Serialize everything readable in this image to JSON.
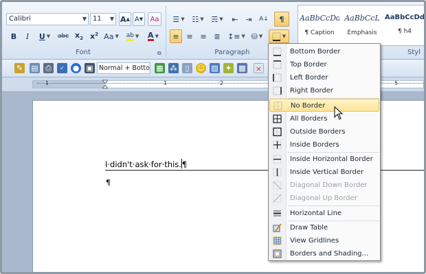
{
  "font_group": {
    "font_name": "Calibri",
    "font_size": "11",
    "label": "Font"
  },
  "paragraph_group": {
    "label": "Paragraph"
  },
  "styles_group": {
    "label": "Styl",
    "tiles": [
      {
        "sample": "AaBbCcDd",
        "name": "¶ Caption"
      },
      {
        "sample": "AaBbCcL",
        "name": "Emphasis"
      },
      {
        "sample": "AaBbCcDd",
        "name": "¶ h4"
      }
    ]
  },
  "quick_toolbar": {
    "style_box": "Normal + Botto"
  },
  "ruler": {
    "numbers": [
      "1",
      "1",
      "2",
      "5"
    ]
  },
  "document": {
    "line1": "I·didn't·ask·for·this.",
    "pilcrow": "¶",
    "para2": "¶"
  },
  "border_menu": {
    "items": [
      {
        "label": "Bottom Border",
        "icon": "bottom-border-icon",
        "enabled": true
      },
      {
        "label": "Top Border",
        "icon": "top-border-icon",
        "enabled": true
      },
      {
        "label": "Left Border",
        "icon": "left-border-icon",
        "enabled": true
      },
      {
        "label": "Right Border",
        "icon": "right-border-icon",
        "enabled": true
      },
      {
        "label": "No Border",
        "icon": "no-border-icon",
        "enabled": true,
        "highlighted": true
      },
      {
        "label": "All Borders",
        "icon": "all-borders-icon",
        "enabled": true
      },
      {
        "label": "Outside Borders",
        "icon": "outside-borders-icon",
        "enabled": true
      },
      {
        "label": "Inside Borders",
        "icon": "inside-borders-icon",
        "enabled": true
      },
      {
        "label": "Inside Horizontal Border",
        "icon": "inside-horizontal-border-icon",
        "enabled": true
      },
      {
        "label": "Inside Vertical Border",
        "icon": "inside-vertical-border-icon",
        "enabled": true
      },
      {
        "label": "Diagonal Down Border",
        "icon": "diagonal-down-border-icon",
        "enabled": false
      },
      {
        "label": "Diagonal Up Border",
        "icon": "diagonal-up-border-icon",
        "enabled": false
      },
      {
        "label": "Horizontal Line",
        "icon": "horizontal-line-icon",
        "enabled": true
      },
      {
        "label": "Draw Table",
        "icon": "draw-table-icon",
        "enabled": true
      },
      {
        "label": "View Gridlines",
        "icon": "view-gridlines-icon",
        "enabled": true
      },
      {
        "label": "Borders and Shading...",
        "icon": "borders-and-shading-icon",
        "enabled": true
      }
    ]
  },
  "colors": {
    "highlight_yellow": "#fde59a",
    "font_color_red": "#d11a1a",
    "ribbon_blue": "#d6e3f2"
  }
}
